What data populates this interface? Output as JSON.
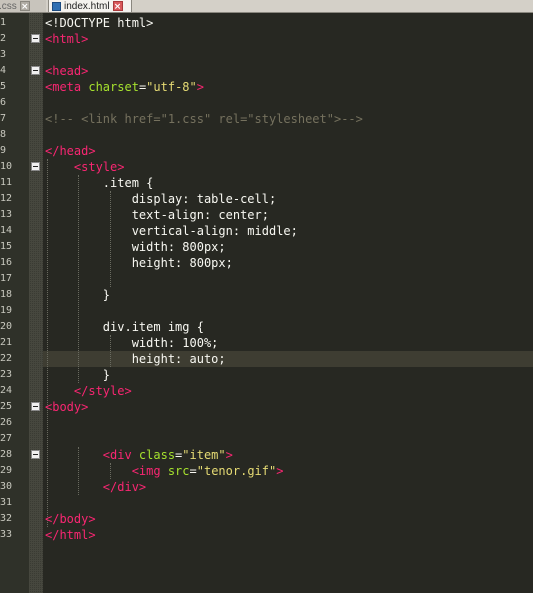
{
  "tabs": [
    {
      "label": ".css",
      "active": false
    },
    {
      "label": "index.html",
      "active": true
    }
  ],
  "colors": {
    "background": "#272822",
    "tag": "#f92672",
    "attribute": "#a6e22e",
    "string": "#e6db74",
    "plain": "#f8f8f2",
    "comment": "#75715e",
    "current_line": "#3e3d32"
  },
  "current_line_number": 22,
  "fold_lines": [
    2,
    4,
    10,
    25,
    28
  ],
  "lines": [
    {
      "n": "1",
      "segs": [
        [
          "plain",
          "<!DOCTYPE html>"
        ]
      ]
    },
    {
      "n": "2",
      "segs": [
        [
          "tag",
          "<html>"
        ]
      ]
    },
    {
      "n": "3",
      "segs": []
    },
    {
      "n": "4",
      "segs": [
        [
          "tag",
          "<head>"
        ]
      ]
    },
    {
      "n": "5",
      "segs": [
        [
          "tag",
          "<meta "
        ],
        [
          "attr",
          "charset"
        ],
        [
          "plain",
          "="
        ],
        [
          "str",
          "\"utf-8\""
        ],
        [
          "tag",
          ">"
        ]
      ]
    },
    {
      "n": "6",
      "segs": []
    },
    {
      "n": "7",
      "segs": [
        [
          "comment",
          "<!-- <link href=\"1.css\" rel=\"stylesheet\">-->"
        ]
      ]
    },
    {
      "n": "8",
      "segs": []
    },
    {
      "n": "9",
      "segs": [
        [
          "tag",
          "</head>"
        ]
      ]
    },
    {
      "n": "10",
      "segs": [
        [
          "plain",
          "    "
        ],
        [
          "tag",
          "<style>"
        ]
      ]
    },
    {
      "n": "11",
      "segs": [
        [
          "plain",
          "        .item {"
        ]
      ]
    },
    {
      "n": "12",
      "segs": [
        [
          "plain",
          "            display: table-cell;"
        ]
      ]
    },
    {
      "n": "13",
      "segs": [
        [
          "plain",
          "            text-align: center;"
        ]
      ]
    },
    {
      "n": "14",
      "segs": [
        [
          "plain",
          "            vertical-align: middle;"
        ]
      ]
    },
    {
      "n": "15",
      "segs": [
        [
          "plain",
          "            width: 800px;"
        ]
      ]
    },
    {
      "n": "16",
      "segs": [
        [
          "plain",
          "            height: 800px;"
        ]
      ]
    },
    {
      "n": "17",
      "segs": []
    },
    {
      "n": "18",
      "segs": [
        [
          "plain",
          "        }"
        ]
      ]
    },
    {
      "n": "19",
      "segs": []
    },
    {
      "n": "20",
      "segs": [
        [
          "plain",
          "        div.item img {"
        ]
      ]
    },
    {
      "n": "21",
      "segs": [
        [
          "plain",
          "            width: 100%;"
        ]
      ]
    },
    {
      "n": "22",
      "segs": [
        [
          "plain",
          "            height: auto;"
        ]
      ]
    },
    {
      "n": "23",
      "segs": [
        [
          "plain",
          "        }"
        ]
      ]
    },
    {
      "n": "24",
      "segs": [
        [
          "plain",
          "    "
        ],
        [
          "tag",
          "</style>"
        ]
      ]
    },
    {
      "n": "25",
      "segs": [
        [
          "tag",
          "<body>"
        ]
      ]
    },
    {
      "n": "26",
      "segs": []
    },
    {
      "n": "27",
      "segs": []
    },
    {
      "n": "28",
      "segs": [
        [
          "plain",
          "        "
        ],
        [
          "tag",
          "<div "
        ],
        [
          "attr",
          "class"
        ],
        [
          "plain",
          "="
        ],
        [
          "str",
          "\"item\""
        ],
        [
          "tag",
          ">"
        ]
      ]
    },
    {
      "n": "29",
      "segs": [
        [
          "plain",
          "            "
        ],
        [
          "tag",
          "<img "
        ],
        [
          "attr",
          "src"
        ],
        [
          "plain",
          "="
        ],
        [
          "str",
          "\"tenor.gif\""
        ],
        [
          "tag",
          ">"
        ]
      ]
    },
    {
      "n": "30",
      "segs": [
        [
          "plain",
          "        "
        ],
        [
          "tag",
          "</div>"
        ]
      ]
    },
    {
      "n": "31",
      "segs": []
    },
    {
      "n": "32",
      "segs": [
        [
          "tag",
          "</body>"
        ]
      ]
    },
    {
      "n": "33",
      "segs": [
        [
          "tag",
          "</html>"
        ]
      ]
    }
  ]
}
